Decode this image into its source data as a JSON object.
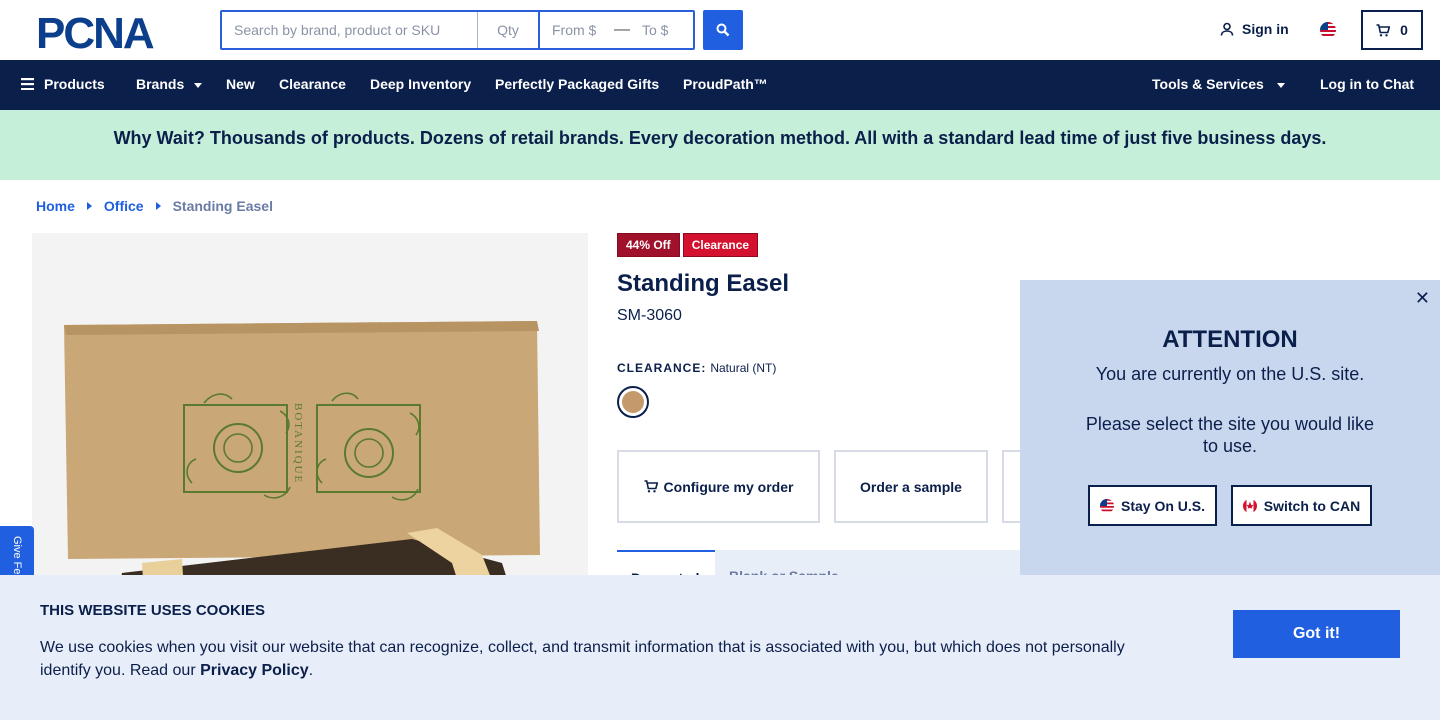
{
  "header": {
    "logo_text": "PCNA",
    "search": {
      "placeholder": "Search by brand, product or SKU",
      "qty_placeholder": "Qty",
      "from_placeholder": "From $",
      "to_placeholder": "To $",
      "separator": "—"
    },
    "signin_label": "Sign in",
    "cart_count": "0"
  },
  "nav": {
    "products": "Products",
    "brands": "Brands",
    "new": "New",
    "clearance": "Clearance",
    "deep_inventory": "Deep Inventory",
    "perfectly_packaged": "Perfectly Packaged Gifts",
    "proudpath": "ProudPath™",
    "tools": "Tools & Services",
    "chat": "Log in to Chat"
  },
  "banner": {
    "text": "Why Wait? Thousands of products. Dozens of retail brands. Every decoration method. All with a standard lead time of just five business days."
  },
  "breadcrumb": {
    "home": "Home",
    "office": "Office",
    "current": "Standing Easel"
  },
  "product": {
    "badge_discount": "44% Off",
    "badge_clearance": "Clearance",
    "title": "Standing Easel",
    "sku": "SM-3060",
    "clearance_label": "CLEARANCE:",
    "color_name": "Natural (NT)",
    "swatch_color": "#c49a6c",
    "box_brand_text": "BOTANIQUE",
    "configure_label": "Configure my order",
    "sample_label": "Order a sample",
    "tab_active": "Decorated",
    "tab_other": "Blank or Sample"
  },
  "feedback": {
    "label": "Give Feedback"
  },
  "modal": {
    "title": "ATTENTION",
    "line1": "You are currently on the U.S. site.",
    "line2": "Please select the site you would like to use.",
    "stay_label": "Stay On U.S.",
    "switch_label": "Switch to CAN"
  },
  "cookie": {
    "title": "THIS WEBSITE USES COOKIES",
    "text": "We use cookies when you visit our website that can recognize, collect, and transmit information that is associated with you, but which does not personally identify you. Read our ",
    "link": "Privacy Policy",
    "period": ".",
    "button": "Got it!"
  },
  "colors": {
    "navy": "#0b1f4b",
    "blue": "#1f5fe0",
    "banner_green": "#c5efd9",
    "clearance_red": "#d41230"
  }
}
